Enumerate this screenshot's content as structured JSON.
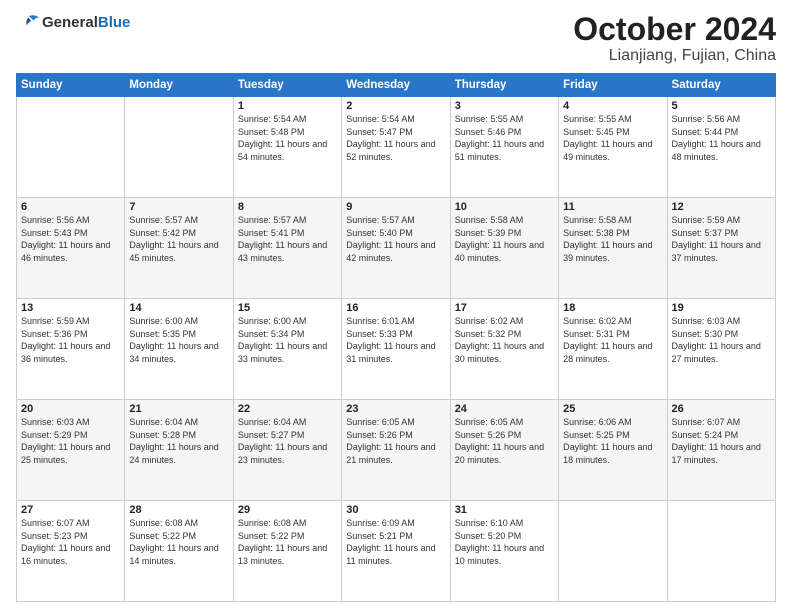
{
  "header": {
    "logo_general": "General",
    "logo_blue": "Blue",
    "month": "October 2024",
    "location": "Lianjiang, Fujian, China"
  },
  "weekdays": [
    "Sunday",
    "Monday",
    "Tuesday",
    "Wednesday",
    "Thursday",
    "Friday",
    "Saturday"
  ],
  "weeks": [
    [
      {
        "day": "",
        "info": ""
      },
      {
        "day": "",
        "info": ""
      },
      {
        "day": "1",
        "info": "Sunrise: 5:54 AM\nSunset: 5:48 PM\nDaylight: 11 hours and 54 minutes."
      },
      {
        "day": "2",
        "info": "Sunrise: 5:54 AM\nSunset: 5:47 PM\nDaylight: 11 hours and 52 minutes."
      },
      {
        "day": "3",
        "info": "Sunrise: 5:55 AM\nSunset: 5:46 PM\nDaylight: 11 hours and 51 minutes."
      },
      {
        "day": "4",
        "info": "Sunrise: 5:55 AM\nSunset: 5:45 PM\nDaylight: 11 hours and 49 minutes."
      },
      {
        "day": "5",
        "info": "Sunrise: 5:56 AM\nSunset: 5:44 PM\nDaylight: 11 hours and 48 minutes."
      }
    ],
    [
      {
        "day": "6",
        "info": "Sunrise: 5:56 AM\nSunset: 5:43 PM\nDaylight: 11 hours and 46 minutes."
      },
      {
        "day": "7",
        "info": "Sunrise: 5:57 AM\nSunset: 5:42 PM\nDaylight: 11 hours and 45 minutes."
      },
      {
        "day": "8",
        "info": "Sunrise: 5:57 AM\nSunset: 5:41 PM\nDaylight: 11 hours and 43 minutes."
      },
      {
        "day": "9",
        "info": "Sunrise: 5:57 AM\nSunset: 5:40 PM\nDaylight: 11 hours and 42 minutes."
      },
      {
        "day": "10",
        "info": "Sunrise: 5:58 AM\nSunset: 5:39 PM\nDaylight: 11 hours and 40 minutes."
      },
      {
        "day": "11",
        "info": "Sunrise: 5:58 AM\nSunset: 5:38 PM\nDaylight: 11 hours and 39 minutes."
      },
      {
        "day": "12",
        "info": "Sunrise: 5:59 AM\nSunset: 5:37 PM\nDaylight: 11 hours and 37 minutes."
      }
    ],
    [
      {
        "day": "13",
        "info": "Sunrise: 5:59 AM\nSunset: 5:36 PM\nDaylight: 11 hours and 36 minutes."
      },
      {
        "day": "14",
        "info": "Sunrise: 6:00 AM\nSunset: 5:35 PM\nDaylight: 11 hours and 34 minutes."
      },
      {
        "day": "15",
        "info": "Sunrise: 6:00 AM\nSunset: 5:34 PM\nDaylight: 11 hours and 33 minutes."
      },
      {
        "day": "16",
        "info": "Sunrise: 6:01 AM\nSunset: 5:33 PM\nDaylight: 11 hours and 31 minutes."
      },
      {
        "day": "17",
        "info": "Sunrise: 6:02 AM\nSunset: 5:32 PM\nDaylight: 11 hours and 30 minutes."
      },
      {
        "day": "18",
        "info": "Sunrise: 6:02 AM\nSunset: 5:31 PM\nDaylight: 11 hours and 28 minutes."
      },
      {
        "day": "19",
        "info": "Sunrise: 6:03 AM\nSunset: 5:30 PM\nDaylight: 11 hours and 27 minutes."
      }
    ],
    [
      {
        "day": "20",
        "info": "Sunrise: 6:03 AM\nSunset: 5:29 PM\nDaylight: 11 hours and 25 minutes."
      },
      {
        "day": "21",
        "info": "Sunrise: 6:04 AM\nSunset: 5:28 PM\nDaylight: 11 hours and 24 minutes."
      },
      {
        "day": "22",
        "info": "Sunrise: 6:04 AM\nSunset: 5:27 PM\nDaylight: 11 hours and 23 minutes."
      },
      {
        "day": "23",
        "info": "Sunrise: 6:05 AM\nSunset: 5:26 PM\nDaylight: 11 hours and 21 minutes."
      },
      {
        "day": "24",
        "info": "Sunrise: 6:05 AM\nSunset: 5:26 PM\nDaylight: 11 hours and 20 minutes."
      },
      {
        "day": "25",
        "info": "Sunrise: 6:06 AM\nSunset: 5:25 PM\nDaylight: 11 hours and 18 minutes."
      },
      {
        "day": "26",
        "info": "Sunrise: 6:07 AM\nSunset: 5:24 PM\nDaylight: 11 hours and 17 minutes."
      }
    ],
    [
      {
        "day": "27",
        "info": "Sunrise: 6:07 AM\nSunset: 5:23 PM\nDaylight: 11 hours and 16 minutes."
      },
      {
        "day": "28",
        "info": "Sunrise: 6:08 AM\nSunset: 5:22 PM\nDaylight: 11 hours and 14 minutes."
      },
      {
        "day": "29",
        "info": "Sunrise: 6:08 AM\nSunset: 5:22 PM\nDaylight: 11 hours and 13 minutes."
      },
      {
        "day": "30",
        "info": "Sunrise: 6:09 AM\nSunset: 5:21 PM\nDaylight: 11 hours and 11 minutes."
      },
      {
        "day": "31",
        "info": "Sunrise: 6:10 AM\nSunset: 5:20 PM\nDaylight: 11 hours and 10 minutes."
      },
      {
        "day": "",
        "info": ""
      },
      {
        "day": "",
        "info": ""
      }
    ]
  ]
}
